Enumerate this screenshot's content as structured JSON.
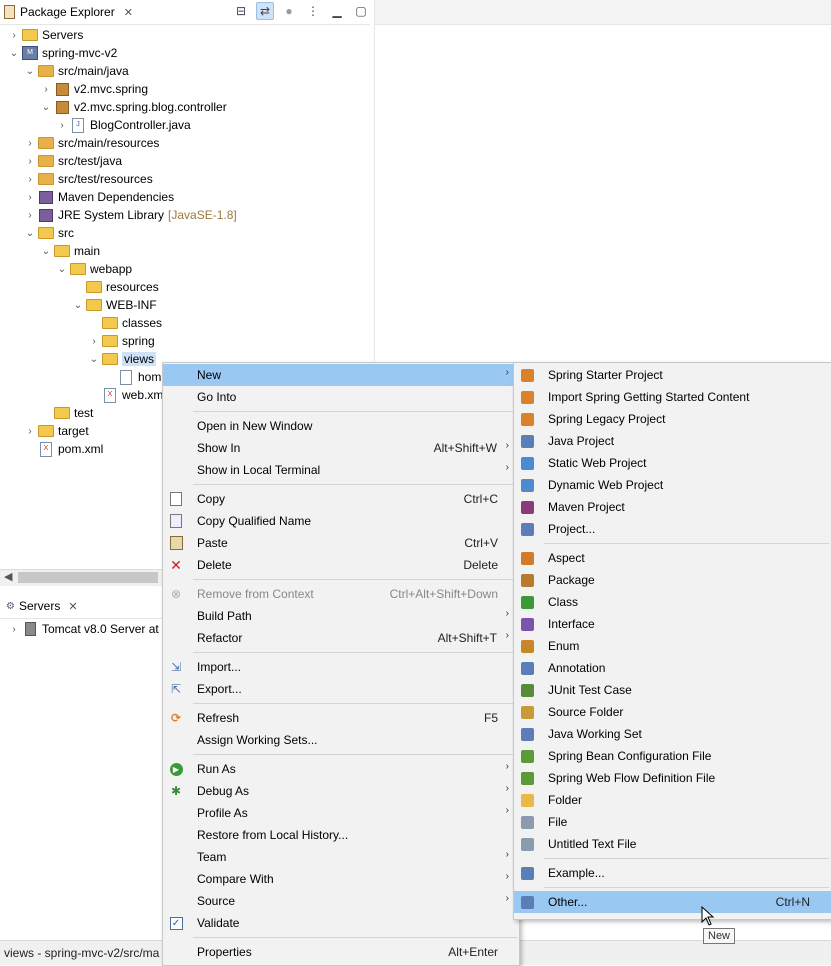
{
  "package_explorer": {
    "title": "Package Explorer",
    "tree": [
      {
        "label": "Servers",
        "decoration": "",
        "depth": 0,
        "expanded": false,
        "icon": "folder-icon"
      },
      {
        "label": "spring-mvc-v2",
        "decoration": "",
        "depth": 0,
        "expanded": true,
        "icon": "project-icon"
      },
      {
        "label": "src/main/java",
        "decoration": "",
        "depth": 1,
        "expanded": true,
        "icon": "source-folder-icon"
      },
      {
        "label": "v2.mvc.spring",
        "decoration": "",
        "depth": 2,
        "expanded": false,
        "icon": "package-icon"
      },
      {
        "label": "v2.mvc.spring.blog.controller",
        "decoration": "",
        "depth": 2,
        "expanded": true,
        "icon": "package-icon"
      },
      {
        "label": "BlogController.java",
        "decoration": "",
        "depth": 3,
        "expanded": false,
        "icon": "java-file-icon"
      },
      {
        "label": "src/main/resources",
        "decoration": "",
        "depth": 1,
        "expanded": false,
        "icon": "source-folder-icon"
      },
      {
        "label": "src/test/java",
        "decoration": "",
        "depth": 1,
        "expanded": false,
        "icon": "source-folder-icon"
      },
      {
        "label": "src/test/resources",
        "decoration": "",
        "depth": 1,
        "expanded": false,
        "icon": "source-folder-icon"
      },
      {
        "label": "Maven Dependencies",
        "decoration": "",
        "depth": 1,
        "expanded": false,
        "icon": "library-icon"
      },
      {
        "label": "JRE System Library",
        "decoration": "[JavaSE-1.8]",
        "depth": 1,
        "expanded": false,
        "icon": "library-icon"
      },
      {
        "label": "src",
        "decoration": "",
        "depth": 1,
        "expanded": true,
        "icon": "folder-icon"
      },
      {
        "label": "main",
        "decoration": "",
        "depth": 2,
        "expanded": true,
        "icon": "folder-icon"
      },
      {
        "label": "webapp",
        "decoration": "",
        "depth": 3,
        "expanded": true,
        "icon": "folder-icon"
      },
      {
        "label": "resources",
        "decoration": "",
        "depth": 4,
        "expanded": null,
        "icon": "folder-icon"
      },
      {
        "label": "WEB-INF",
        "decoration": "",
        "depth": 4,
        "expanded": true,
        "icon": "folder-icon"
      },
      {
        "label": "classes",
        "decoration": "",
        "depth": 5,
        "expanded": null,
        "icon": "folder-icon"
      },
      {
        "label": "spring",
        "decoration": "",
        "depth": 5,
        "expanded": false,
        "icon": "folder-icon"
      },
      {
        "label": "views",
        "decoration": "",
        "depth": 5,
        "expanded": true,
        "icon": "folder-icon",
        "selected": true
      },
      {
        "label": "hom",
        "decoration": "",
        "depth": 6,
        "expanded": null,
        "icon": "file-icon"
      },
      {
        "label": "web.xm",
        "decoration": "",
        "depth": 5,
        "expanded": null,
        "icon": "xml-file-icon"
      },
      {
        "label": "test",
        "decoration": "",
        "depth": 2,
        "expanded": null,
        "icon": "folder-icon"
      },
      {
        "label": "target",
        "decoration": "",
        "depth": 1,
        "expanded": false,
        "icon": "folder-icon"
      },
      {
        "label": "pom.xml",
        "decoration": "",
        "depth": 1,
        "expanded": null,
        "icon": "xml-file-icon"
      }
    ]
  },
  "servers_view": {
    "title": "Servers",
    "row": "Tomcat v8.0 Server at"
  },
  "status_bar": {
    "text": "views - spring-mvc-v2/src/ma"
  },
  "context_menu": [
    {
      "label": "New",
      "accel": "",
      "submenu": true,
      "icon": "",
      "highlight": true
    },
    {
      "label": "Go Into",
      "accel": "",
      "submenu": false,
      "icon": ""
    },
    {
      "sep": true
    },
    {
      "label": "Open in New Window",
      "accel": "",
      "submenu": false,
      "icon": ""
    },
    {
      "label": "Show In",
      "accel": "Alt+Shift+W",
      "submenu": true,
      "icon": ""
    },
    {
      "label": "Show in Local Terminal",
      "accel": "",
      "submenu": true,
      "icon": ""
    },
    {
      "sep": true
    },
    {
      "label": "Copy",
      "accel": "Ctrl+C",
      "submenu": false,
      "icon": "copy-icon"
    },
    {
      "label": "Copy Qualified Name",
      "accel": "",
      "submenu": false,
      "icon": "copy-qualified-icon"
    },
    {
      "label": "Paste",
      "accel": "Ctrl+V",
      "submenu": false,
      "icon": "paste-icon"
    },
    {
      "label": "Delete",
      "accel": "Delete",
      "submenu": false,
      "icon": "delete-icon"
    },
    {
      "sep": true
    },
    {
      "label": "Remove from Context",
      "accel": "Ctrl+Alt+Shift+Down",
      "submenu": false,
      "icon": "remove-context-icon",
      "disabled": true
    },
    {
      "label": "Build Path",
      "accel": "",
      "submenu": true,
      "icon": ""
    },
    {
      "label": "Refactor",
      "accel": "Alt+Shift+T",
      "submenu": true,
      "icon": ""
    },
    {
      "sep": true
    },
    {
      "label": "Import...",
      "accel": "",
      "submenu": false,
      "icon": "import-icon"
    },
    {
      "label": "Export...",
      "accel": "",
      "submenu": false,
      "icon": "export-icon"
    },
    {
      "sep": true
    },
    {
      "label": "Refresh",
      "accel": "F5",
      "submenu": false,
      "icon": "refresh-icon"
    },
    {
      "label": "Assign Working Sets...",
      "accel": "",
      "submenu": false,
      "icon": ""
    },
    {
      "sep": true
    },
    {
      "label": "Run As",
      "accel": "",
      "submenu": true,
      "icon": "run-icon"
    },
    {
      "label": "Debug As",
      "accel": "",
      "submenu": true,
      "icon": "debug-icon"
    },
    {
      "label": "Profile As",
      "accel": "",
      "submenu": true,
      "icon": ""
    },
    {
      "label": "Restore from Local History...",
      "accel": "",
      "submenu": false,
      "icon": ""
    },
    {
      "label": "Team",
      "accel": "",
      "submenu": true,
      "icon": ""
    },
    {
      "label": "Compare With",
      "accel": "",
      "submenu": true,
      "icon": ""
    },
    {
      "label": "Source",
      "accel": "",
      "submenu": true,
      "icon": ""
    },
    {
      "label": "Validate",
      "accel": "",
      "submenu": false,
      "icon": "checkbox-icon"
    },
    {
      "sep": true
    },
    {
      "label": "Properties",
      "accel": "Alt+Enter",
      "submenu": false,
      "icon": ""
    }
  ],
  "new_submenu": [
    {
      "label": "Spring Starter Project",
      "icon": "spring-starter-icon",
      "color": "#d9822b"
    },
    {
      "label": "Import Spring Getting Started Content",
      "icon": "spring-import-icon",
      "color": "#d9822b"
    },
    {
      "label": "Spring Legacy Project",
      "icon": "spring-legacy-icon",
      "color": "#d9822b"
    },
    {
      "label": "Java Project",
      "icon": "java-project-icon",
      "color": "#5b7db8"
    },
    {
      "label": "Static Web Project",
      "icon": "static-web-icon",
      "color": "#4f8ad0"
    },
    {
      "label": "Dynamic Web Project",
      "icon": "dynamic-web-icon",
      "color": "#4f8ad0"
    },
    {
      "label": "Maven Project",
      "icon": "maven-icon",
      "color": "#8a3b7d"
    },
    {
      "label": "Project...",
      "icon": "project-icon",
      "color": "#5b7db8"
    },
    {
      "sep": true
    },
    {
      "label": "Aspect",
      "icon": "aspect-icon",
      "color": "#d07a2a"
    },
    {
      "label": "Package",
      "icon": "package-icon",
      "color": "#b67a30"
    },
    {
      "label": "Class",
      "icon": "class-icon",
      "color": "#3a9a3a"
    },
    {
      "label": "Interface",
      "icon": "interface-icon",
      "color": "#7a55b0"
    },
    {
      "label": "Enum",
      "icon": "enum-icon",
      "color": "#c8862a"
    },
    {
      "label": "Annotation",
      "icon": "annotation-icon",
      "color": "#5b7db8"
    },
    {
      "label": "JUnit Test Case",
      "icon": "junit-icon",
      "color": "#5b8a3a"
    },
    {
      "label": "Source Folder",
      "icon": "source-folder-icon",
      "color": "#c89a3a"
    },
    {
      "label": "Java Working Set",
      "icon": "working-set-icon",
      "color": "#5b7db8"
    },
    {
      "label": "Spring Bean Configuration File",
      "icon": "spring-bean-icon",
      "color": "#5a9a3a"
    },
    {
      "label": "Spring Web Flow Definition File",
      "icon": "spring-webflow-icon",
      "color": "#5a9a3a"
    },
    {
      "label": "Folder",
      "icon": "folder-icon",
      "color": "#e8b84a"
    },
    {
      "label": "File",
      "icon": "file-icon",
      "color": "#8a9ab0"
    },
    {
      "label": "Untitled Text File",
      "icon": "text-file-icon",
      "color": "#8a9ab0"
    },
    {
      "sep": true
    },
    {
      "label": "Example...",
      "icon": "example-icon",
      "color": "#5b7db8"
    },
    {
      "sep": true
    },
    {
      "label": "Other...",
      "accel": "Ctrl+N",
      "icon": "other-icon",
      "color": "#5b7db8",
      "highlight": true
    }
  ],
  "tooltip": "New"
}
